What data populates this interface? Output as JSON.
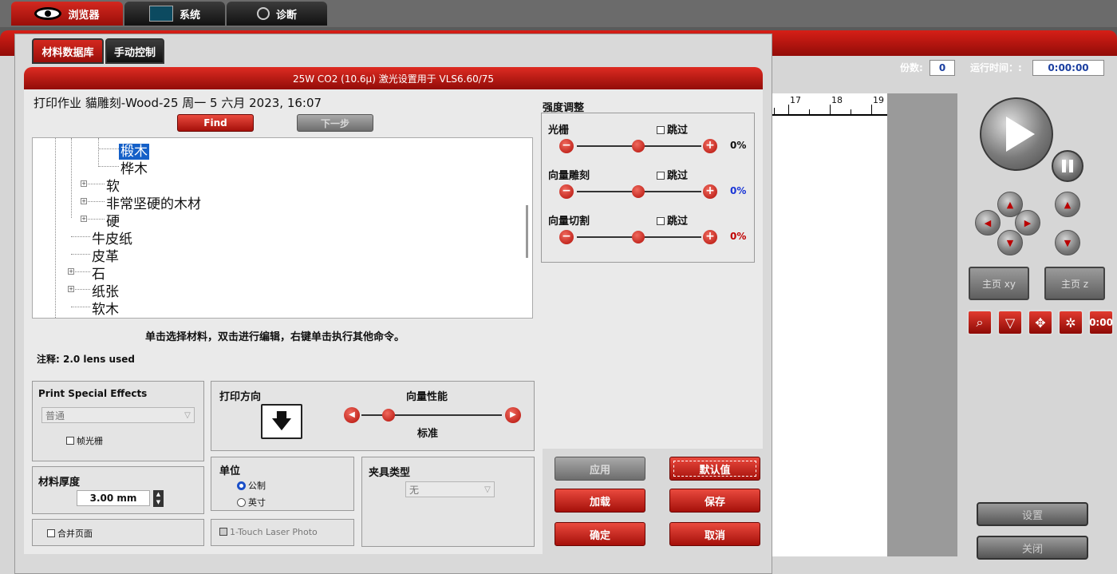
{
  "top_tabs": [
    {
      "label": "浏览器",
      "icon": "eye-icon"
    },
    {
      "label": "系统",
      "icon": "monitor-icon"
    },
    {
      "label": "诊断",
      "icon": "stethoscope-icon"
    }
  ],
  "status": {
    "copies_label": "份数:",
    "copies_value": "0",
    "runtime_label": "运行时间：:",
    "runtime_value": "0:00:00"
  },
  "ruler_ticks": [
    "17",
    "18",
    "19"
  ],
  "right_panel": {
    "home_xy": "主页 xy",
    "home_z": "主页 z",
    "timer_icon_text": "0:00",
    "settings": "设置",
    "close": "关闭"
  },
  "dialog": {
    "tabs": [
      "材料数据库",
      "手动控制"
    ],
    "banner": "25W CO2 (10.6μ) 激光设置用于 VLS6.60/75",
    "print_job": "打印作业 貓雕刻-Wood-25 周一 5 六月 2023, 16:07",
    "find_button": "Find",
    "next_button": "下一步",
    "tree_items": [
      "椴木",
      "桦木",
      "软",
      "非常坚硬的木材",
      "硬",
      "牛皮纸",
      "皮革",
      "石",
      "纸张",
      "软木"
    ],
    "hint": "单击选择材料，双击进行编辑，右键单击执行其他命令。",
    "note": "注释: 2.0 lens used",
    "power": {
      "title": "强度调整",
      "rows": [
        {
          "label": "光栅",
          "skip": "跳过",
          "value": "0%",
          "color": "#000000"
        },
        {
          "label": "向量雕刻",
          "skip": "跳过",
          "value": "0%",
          "color": "#1a35d6"
        },
        {
          "label": "向量切割",
          "skip": "跳过",
          "value": "0%",
          "color": "#c00000"
        }
      ]
    },
    "special_effects": {
      "title": "Print Special Effects",
      "select_value": "普通",
      "checkbox_label": "帧光栅"
    },
    "thickness": {
      "title": "材料厚度",
      "value": "3.00 mm"
    },
    "merge_pages": "合并页面",
    "print_direction": "打印方向",
    "vector_performance": {
      "title": "向量性能",
      "value_label": "标准"
    },
    "units": {
      "title": "单位",
      "options": [
        "公制",
        "英寸"
      ],
      "selected": "公制"
    },
    "fixture": {
      "title": "夹具类型",
      "select_value": "无"
    },
    "one_touch": "1-Touch Laser Photo",
    "buttons": {
      "apply": "应用",
      "default": "默认值",
      "load": "加载",
      "save": "保存",
      "ok": "确定",
      "cancel": "取消"
    }
  }
}
